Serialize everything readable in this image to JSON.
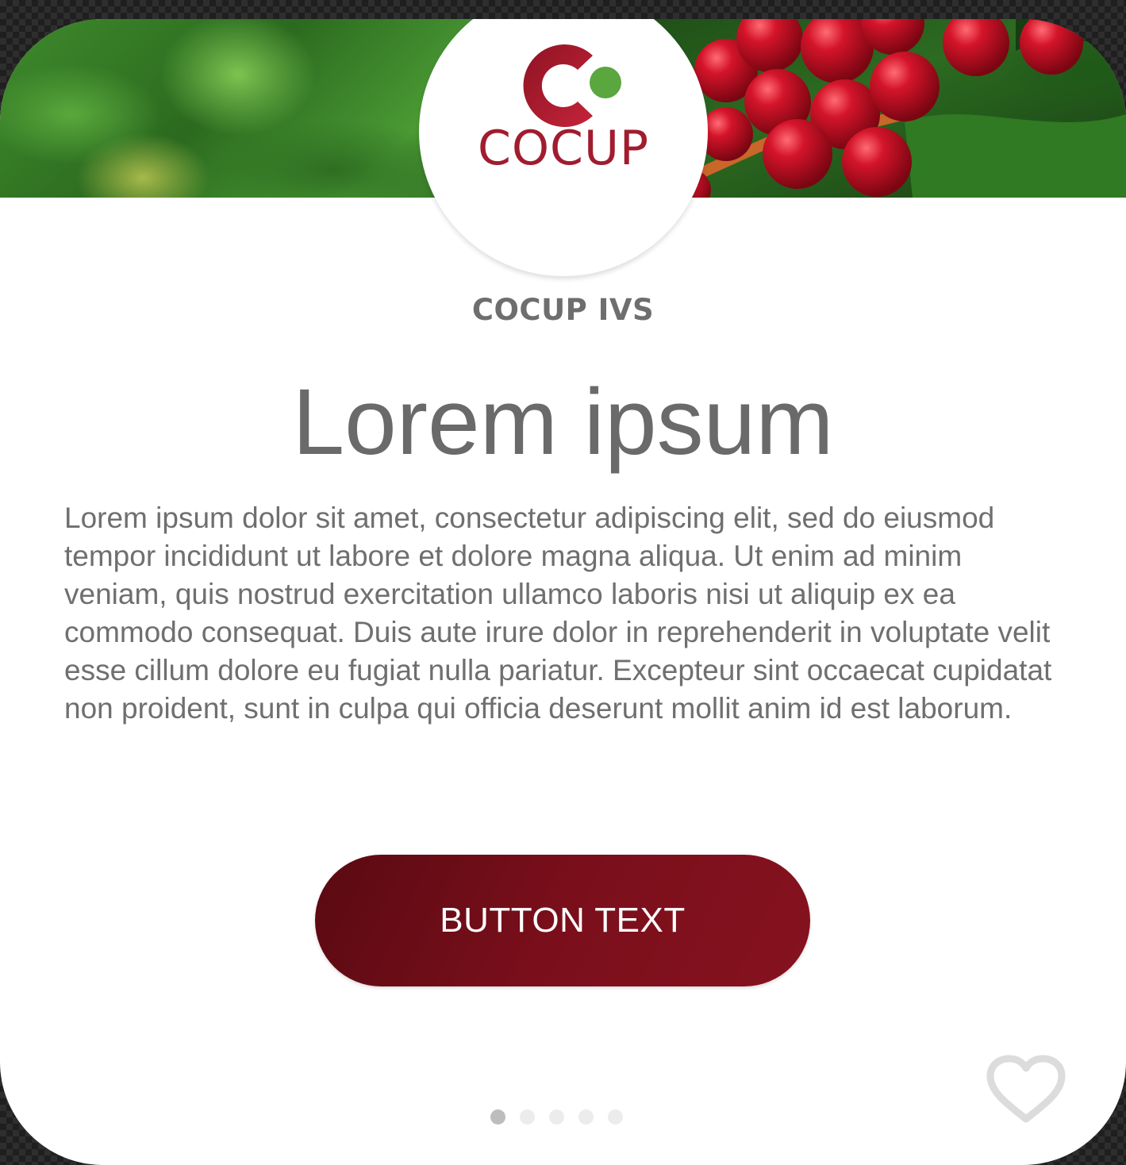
{
  "brand": {
    "logo_word": "COCUP",
    "primary_color": "#a01c2e",
    "dot_color": "#5aa63f"
  },
  "card": {
    "company": "COCUP IVS",
    "headline": "Lorem ipsum",
    "body": "Lorem ipsum dolor sit amet, consectetur adipiscing elit, sed do eiusmod tempor incididunt ut labore et dolore magna aliqua. Ut enim ad minim veniam, quis nostrud exercitation ullamco laboris nisi ut aliquip ex ea commodo consequat. Duis aute irure dolor in reprehenderit in voluptate velit esse cillum dolore eu fugiat nulla pariatur. Excepteur sint occaecat cupidatat non proident, sunt in culpa qui officia deserunt mollit anim id est laborum.",
    "button_label": "BUTTON TEXT",
    "button_color": "#7a0f1b"
  },
  "pagination": {
    "total": 5,
    "active_index": 0
  },
  "icons": {
    "favorite": "heart-outline-icon"
  }
}
